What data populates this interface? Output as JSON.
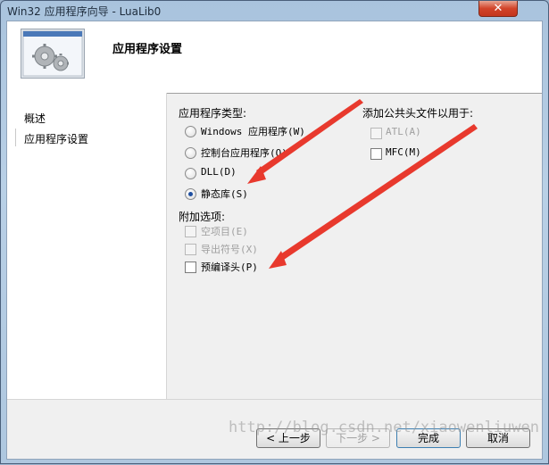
{
  "window": {
    "title": "Win32 应用程序向导 - LuaLib0",
    "close_glyph": "✕"
  },
  "header": {
    "title": "应用程序设置",
    "icon": "gear-icon"
  },
  "nav": {
    "items": [
      "概述",
      "应用程序设置"
    ]
  },
  "app_type": {
    "label": "应用程序类型:",
    "options": [
      {
        "label": "Windows 应用程序(W)",
        "selected": false
      },
      {
        "label": "控制台应用程序(O)",
        "selected": false
      },
      {
        "label": "DLL(D)",
        "selected": false
      },
      {
        "label": "静态库(S)",
        "selected": true
      }
    ]
  },
  "additional": {
    "label": "附加选项:",
    "options": [
      {
        "label": "空项目(E)",
        "checked": false,
        "enabled": false
      },
      {
        "label": "导出符号(X)",
        "checked": false,
        "enabled": false
      },
      {
        "label": "预编译头(P)",
        "checked": false,
        "enabled": true
      }
    ]
  },
  "common_headers": {
    "label": "添加公共头文件以用于:",
    "options": [
      {
        "label": "ATL(A)",
        "checked": false,
        "enabled": false
      },
      {
        "label": "MFC(M)",
        "checked": false,
        "enabled": true
      }
    ]
  },
  "buttons": {
    "prev": "< 上一步",
    "next": "下一步 >",
    "finish": "完成",
    "cancel": "取消"
  },
  "watermark": "http://blog.csdn.net/xiaowenliuwen",
  "colors": {
    "annotation_arrow": "#e8392d"
  }
}
